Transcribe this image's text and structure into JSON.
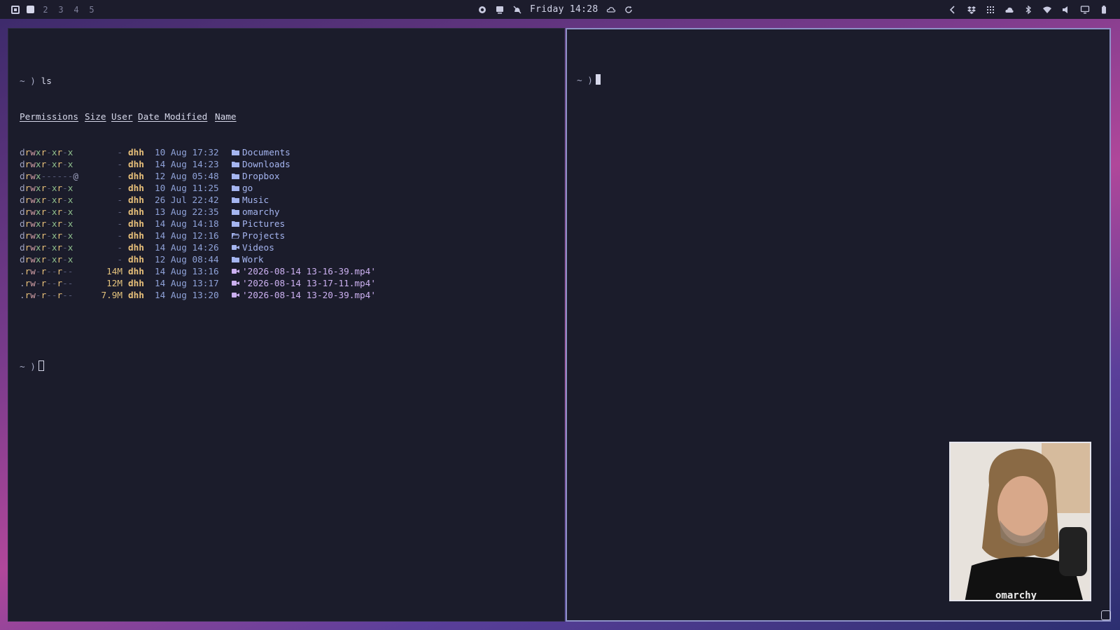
{
  "topbar": {
    "workspaces": [
      "2",
      "3",
      "4",
      "5"
    ],
    "clock": "Friday 14:28",
    "center_icons": [
      "record-icon",
      "keyboard-icon",
      "bell-off-icon"
    ],
    "weather_icons": [
      "cloud-icon",
      "refresh-icon"
    ],
    "right_icons": [
      "chevron-left-icon",
      "dropbox-icon",
      "grid-icon",
      "cloud-sync-icon",
      "bluetooth-icon",
      "wifi-icon",
      "volume-icon",
      "display-icon",
      "battery-icon"
    ]
  },
  "left_terminal": {
    "prompt": "~ )",
    "command": "ls",
    "headers": [
      "Permissions",
      "Size",
      "User",
      "Date Modified",
      "Name"
    ],
    "rows": [
      {
        "perm": "drwxr-xr-x",
        "size": "-",
        "user": "dhh",
        "date": "10 Aug 17:32",
        "name": "Documents",
        "type": "dir"
      },
      {
        "perm": "drwxr-xr-x",
        "size": "-",
        "user": "dhh",
        "date": "14 Aug 14:23",
        "name": "Downloads",
        "type": "dir"
      },
      {
        "perm": "drwx------@",
        "size": "-",
        "user": "dhh",
        "date": "12 Aug 05:48",
        "name": "Dropbox",
        "type": "dir"
      },
      {
        "perm": "drwxr-xr-x",
        "size": "-",
        "user": "dhh",
        "date": "10 Aug 11:25",
        "name": "go",
        "type": "dir"
      },
      {
        "perm": "drwxr-xr-x",
        "size": "-",
        "user": "dhh",
        "date": "26 Jul 22:42",
        "name": "Music",
        "type": "dir"
      },
      {
        "perm": "drwxr-xr-x",
        "size": "-",
        "user": "dhh",
        "date": "13 Aug 22:35",
        "name": "omarchy",
        "type": "dir"
      },
      {
        "perm": "drwxr-xr-x",
        "size": "-",
        "user": "dhh",
        "date": "14 Aug 14:18",
        "name": "Pictures",
        "type": "dir"
      },
      {
        "perm": "drwxr-xr-x",
        "size": "-",
        "user": "dhh",
        "date": "14 Aug 12:16",
        "name": "Projects",
        "type": "dir-open"
      },
      {
        "perm": "drwxr-xr-x",
        "size": "-",
        "user": "dhh",
        "date": "14 Aug 14:26",
        "name": "Videos",
        "type": "video-dir"
      },
      {
        "perm": "drwxr-xr-x",
        "size": "-",
        "user": "dhh",
        "date": "12 Aug 08:44",
        "name": "Work",
        "type": "dir"
      },
      {
        "perm": ".rw-r--r--",
        "size": "14M",
        "user": "dhh",
        "date": "14 Aug 13:16",
        "name": "'2026-08-14 13-16-39.mp4'",
        "type": "video"
      },
      {
        "perm": ".rw-r--r--",
        "size": "12M",
        "user": "dhh",
        "date": "14 Aug 13:17",
        "name": "'2026-08-14 13-17-11.mp4'",
        "type": "video"
      },
      {
        "perm": ".rw-r--r--",
        "size": "7.9M",
        "user": "dhh",
        "date": "14 Aug 13:20",
        "name": "'2026-08-14 13-20-39.mp4'",
        "type": "video"
      }
    ],
    "final_prompt": "~ )"
  },
  "right_terminal": {
    "prompt": "~ )"
  },
  "webcam": {
    "shirt_text": "omarchy"
  },
  "colors": {
    "terminal_bg": "#1b1c2b",
    "topbar_bg": "#1c1c2c",
    "active_border": "#8d92c6",
    "user": "#e8c07a",
    "directory": "#a5b5f0"
  }
}
